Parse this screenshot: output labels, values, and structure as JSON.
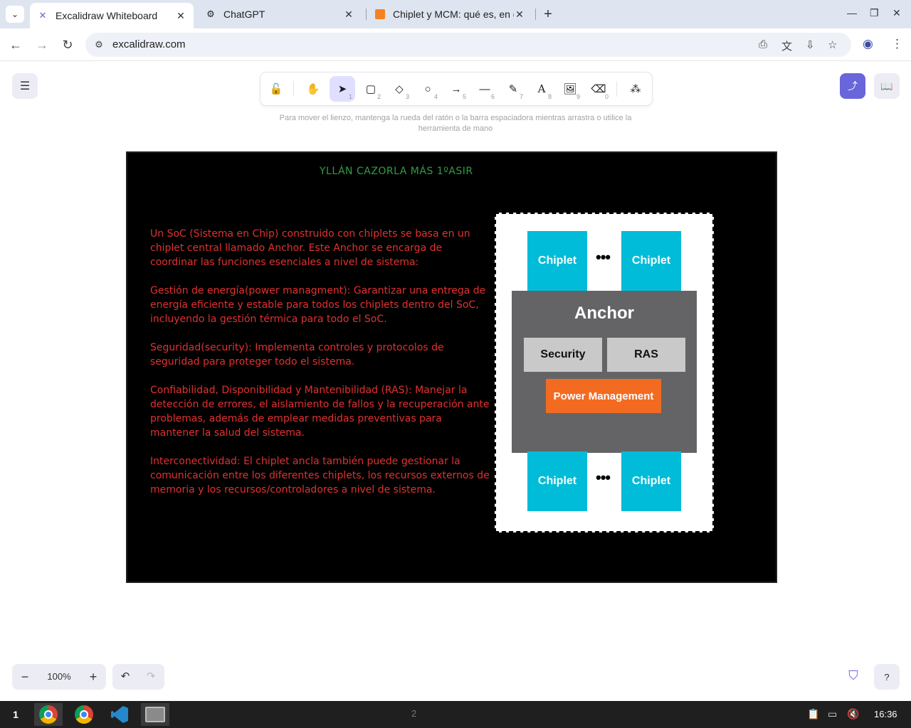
{
  "browser": {
    "tabs": [
      {
        "title": "Excalidraw Whiteboard",
        "icon": "excalidraw-icon",
        "active": true
      },
      {
        "title": "ChatGPT",
        "icon": "openai-icon",
        "active": false
      },
      {
        "title": "Chiplet y MCM: qué es, en qu",
        "icon": "article-icon",
        "active": false
      }
    ],
    "url": "excalidraw.com"
  },
  "toolbar": {
    "tools": [
      {
        "name": "lock",
        "glyph": "🔓",
        "num": ""
      },
      {
        "name": "hand",
        "glyph": "✋",
        "num": ""
      },
      {
        "name": "selection",
        "glyph": "➤",
        "num": "1"
      },
      {
        "name": "rectangle",
        "glyph": "▢",
        "num": "2"
      },
      {
        "name": "diamond",
        "glyph": "◇",
        "num": "3"
      },
      {
        "name": "ellipse",
        "glyph": "○",
        "num": "4"
      },
      {
        "name": "arrow",
        "glyph": "→",
        "num": "5"
      },
      {
        "name": "line",
        "glyph": "—",
        "num": "6"
      },
      {
        "name": "draw",
        "glyph": "✎",
        "num": "7"
      },
      {
        "name": "text",
        "glyph": "A",
        "num": "8"
      },
      {
        "name": "image",
        "glyph": "🖼",
        "num": "9"
      },
      {
        "name": "eraser",
        "glyph": "⌫",
        "num": "0"
      },
      {
        "name": "more-tools",
        "glyph": "⁂",
        "num": ""
      }
    ],
    "hint": "Para mover el lienzo, mantenga la rueda del ratón o la barra espaciadora mientras arrastra o utilice la herramienta de mano"
  },
  "board": {
    "title": "YLLÁN CAZORLA MÁS 1ºASIR",
    "paragraphs": [
      "Un SoC (Sistema en Chip) construido con chiplets se basa en un chiplet central llamado Anchor. Este Anchor se encarga de coordinar las funciones esenciales a nivel de sistema:",
      "Gestión de energía(power managment): Garantizar una entrega de energía eficiente y estable para todos los chiplets dentro del SoC, incluyendo la gestión térmica para todo el SoC.",
      "Seguridad(security): Implementa controles y protocolos de seguridad para proteger todo el sistema.",
      "Confiabilidad, Disponibilidad y Mantenibilidad (RAS): Manejar la detección de errores, el aislamiento de fallos y la recuperación ante problemas, además de emplear medidas preventivas para mantener la salud del sistema.",
      "Interconectividad: El chiplet ancla también puede gestionar la comunicación entre los diferentes chiplets, los recursos externos de memoria y los recursos/controladores a nivel de sistema."
    ],
    "diagram": {
      "chiplet_label": "Chiplet",
      "dots": "•••",
      "anchor": "Anchor",
      "security": "Security",
      "ras": "RAS",
      "power": "Power Management"
    }
  },
  "footer": {
    "zoom": "100%"
  },
  "taskbar": {
    "workspace": "1",
    "workspace2": "2",
    "time": "16:36"
  },
  "colors": {
    "accent": "#6965db",
    "title_green": "#2f9e44",
    "text_red": "#e03131",
    "chiplet_cyan": "#00bcd8",
    "anchor_gray": "#646466",
    "power_orange": "#f36b21"
  }
}
